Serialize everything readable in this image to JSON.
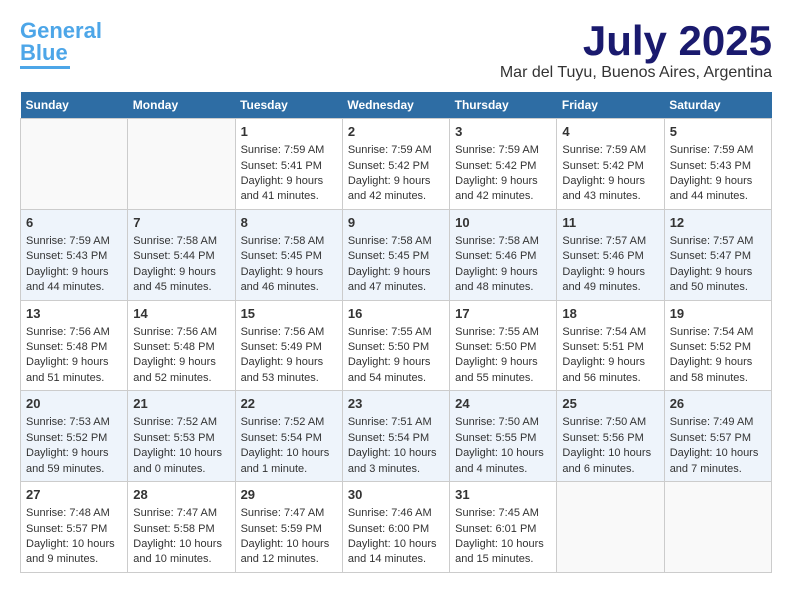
{
  "header": {
    "logo_line1": "General",
    "logo_line2": "Blue",
    "month": "July 2025",
    "location": "Mar del Tuyu, Buenos Aires, Argentina"
  },
  "weekdays": [
    "Sunday",
    "Monday",
    "Tuesday",
    "Wednesday",
    "Thursday",
    "Friday",
    "Saturday"
  ],
  "weeks": [
    [
      {
        "day": "",
        "info": ""
      },
      {
        "day": "",
        "info": ""
      },
      {
        "day": "1",
        "info": "Sunrise: 7:59 AM\nSunset: 5:41 PM\nDaylight: 9 hours and 41 minutes."
      },
      {
        "day": "2",
        "info": "Sunrise: 7:59 AM\nSunset: 5:42 PM\nDaylight: 9 hours and 42 minutes."
      },
      {
        "day": "3",
        "info": "Sunrise: 7:59 AM\nSunset: 5:42 PM\nDaylight: 9 hours and 42 minutes."
      },
      {
        "day": "4",
        "info": "Sunrise: 7:59 AM\nSunset: 5:42 PM\nDaylight: 9 hours and 43 minutes."
      },
      {
        "day": "5",
        "info": "Sunrise: 7:59 AM\nSunset: 5:43 PM\nDaylight: 9 hours and 44 minutes."
      }
    ],
    [
      {
        "day": "6",
        "info": "Sunrise: 7:59 AM\nSunset: 5:43 PM\nDaylight: 9 hours and 44 minutes."
      },
      {
        "day": "7",
        "info": "Sunrise: 7:58 AM\nSunset: 5:44 PM\nDaylight: 9 hours and 45 minutes."
      },
      {
        "day": "8",
        "info": "Sunrise: 7:58 AM\nSunset: 5:45 PM\nDaylight: 9 hours and 46 minutes."
      },
      {
        "day": "9",
        "info": "Sunrise: 7:58 AM\nSunset: 5:45 PM\nDaylight: 9 hours and 47 minutes."
      },
      {
        "day": "10",
        "info": "Sunrise: 7:58 AM\nSunset: 5:46 PM\nDaylight: 9 hours and 48 minutes."
      },
      {
        "day": "11",
        "info": "Sunrise: 7:57 AM\nSunset: 5:46 PM\nDaylight: 9 hours and 49 minutes."
      },
      {
        "day": "12",
        "info": "Sunrise: 7:57 AM\nSunset: 5:47 PM\nDaylight: 9 hours and 50 minutes."
      }
    ],
    [
      {
        "day": "13",
        "info": "Sunrise: 7:56 AM\nSunset: 5:48 PM\nDaylight: 9 hours and 51 minutes."
      },
      {
        "day": "14",
        "info": "Sunrise: 7:56 AM\nSunset: 5:48 PM\nDaylight: 9 hours and 52 minutes."
      },
      {
        "day": "15",
        "info": "Sunrise: 7:56 AM\nSunset: 5:49 PM\nDaylight: 9 hours and 53 minutes."
      },
      {
        "day": "16",
        "info": "Sunrise: 7:55 AM\nSunset: 5:50 PM\nDaylight: 9 hours and 54 minutes."
      },
      {
        "day": "17",
        "info": "Sunrise: 7:55 AM\nSunset: 5:50 PM\nDaylight: 9 hours and 55 minutes."
      },
      {
        "day": "18",
        "info": "Sunrise: 7:54 AM\nSunset: 5:51 PM\nDaylight: 9 hours and 56 minutes."
      },
      {
        "day": "19",
        "info": "Sunrise: 7:54 AM\nSunset: 5:52 PM\nDaylight: 9 hours and 58 minutes."
      }
    ],
    [
      {
        "day": "20",
        "info": "Sunrise: 7:53 AM\nSunset: 5:52 PM\nDaylight: 9 hours and 59 minutes."
      },
      {
        "day": "21",
        "info": "Sunrise: 7:52 AM\nSunset: 5:53 PM\nDaylight: 10 hours and 0 minutes."
      },
      {
        "day": "22",
        "info": "Sunrise: 7:52 AM\nSunset: 5:54 PM\nDaylight: 10 hours and 1 minute."
      },
      {
        "day": "23",
        "info": "Sunrise: 7:51 AM\nSunset: 5:54 PM\nDaylight: 10 hours and 3 minutes."
      },
      {
        "day": "24",
        "info": "Sunrise: 7:50 AM\nSunset: 5:55 PM\nDaylight: 10 hours and 4 minutes."
      },
      {
        "day": "25",
        "info": "Sunrise: 7:50 AM\nSunset: 5:56 PM\nDaylight: 10 hours and 6 minutes."
      },
      {
        "day": "26",
        "info": "Sunrise: 7:49 AM\nSunset: 5:57 PM\nDaylight: 10 hours and 7 minutes."
      }
    ],
    [
      {
        "day": "27",
        "info": "Sunrise: 7:48 AM\nSunset: 5:57 PM\nDaylight: 10 hours and 9 minutes."
      },
      {
        "day": "28",
        "info": "Sunrise: 7:47 AM\nSunset: 5:58 PM\nDaylight: 10 hours and 10 minutes."
      },
      {
        "day": "29",
        "info": "Sunrise: 7:47 AM\nSunset: 5:59 PM\nDaylight: 10 hours and 12 minutes."
      },
      {
        "day": "30",
        "info": "Sunrise: 7:46 AM\nSunset: 6:00 PM\nDaylight: 10 hours and 14 minutes."
      },
      {
        "day": "31",
        "info": "Sunrise: 7:45 AM\nSunset: 6:01 PM\nDaylight: 10 hours and 15 minutes."
      },
      {
        "day": "",
        "info": ""
      },
      {
        "day": "",
        "info": ""
      }
    ]
  ]
}
